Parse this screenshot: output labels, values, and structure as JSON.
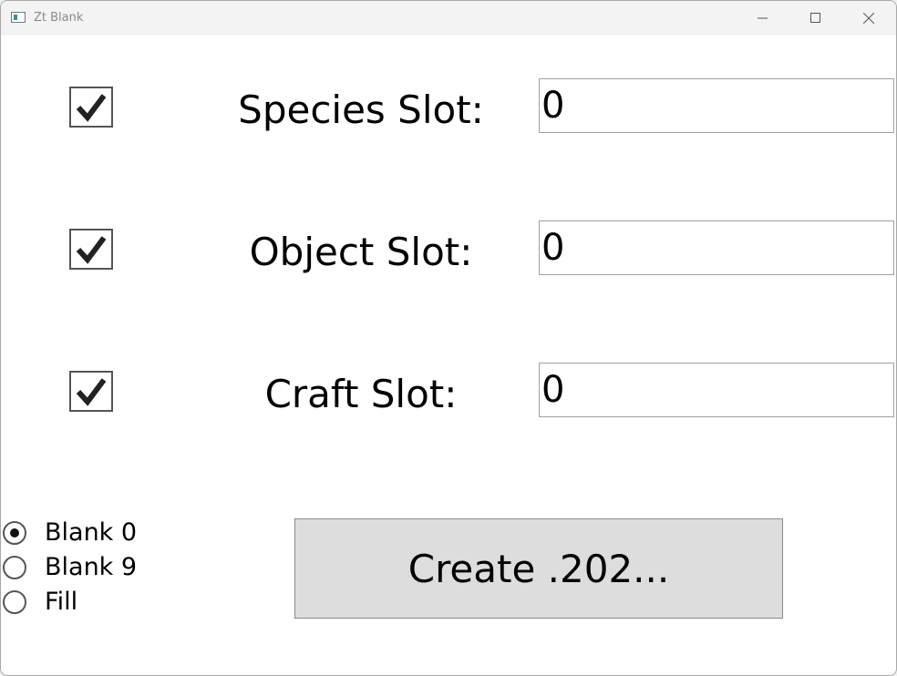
{
  "window": {
    "title": "Zt Blank"
  },
  "slots": [
    {
      "label": "Species Slot:",
      "value": "0",
      "checked": true
    },
    {
      "label": "Object Slot:",
      "value": "0",
      "checked": true
    },
    {
      "label": "Craft Slot:",
      "value": "0",
      "checked": true
    }
  ],
  "modes": {
    "options": [
      "Blank 0",
      "Blank 9",
      "Fill"
    ],
    "selected": "Blank 0"
  },
  "actions": {
    "create_label": "Create .202..."
  },
  "colors": {
    "button_bg": "#dddddd",
    "titlebar_bg": "#f3f3f3"
  }
}
